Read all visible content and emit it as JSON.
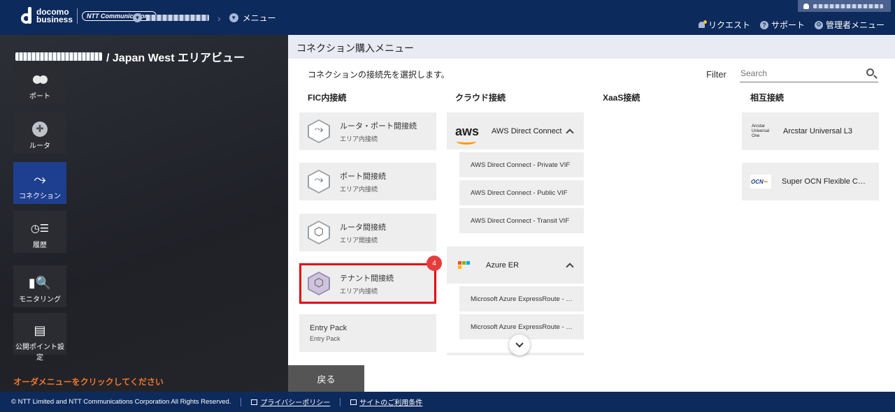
{
  "header": {
    "logo_line1": "docomo",
    "logo_line2": "business",
    "ntt_logo": "NTT Communications",
    "menu_crumb": "メニュー",
    "nav": {
      "request": "リクエスト",
      "support": "サポート",
      "admin_menu": "管理者メニュー"
    }
  },
  "left_panel": {
    "area_title": "/ Japan West エリアビュー",
    "items": [
      {
        "label": "ポート",
        "icon": "port-icon"
      },
      {
        "label": "ルータ",
        "icon": "router-icon"
      },
      {
        "label": "コネクション",
        "icon": "connection-icon"
      },
      {
        "label": "履歴",
        "icon": "history-icon"
      },
      {
        "label": "モニタリング",
        "icon": "monitoring-icon"
      },
      {
        "label": "公開ポイント設定",
        "icon": "public-point-icon"
      }
    ],
    "order_hint": "オーダメニューをクリックしてください"
  },
  "main": {
    "title": "コネクション購入メニュー",
    "instruction": "コネクションの接続先を選択します。",
    "filter_label": "Filter",
    "search_placeholder": "Search",
    "columns": {
      "fic": "FIC内接続",
      "cloud": "クラウド接続",
      "xaas": "XaaS接続",
      "mutual": "相互接続"
    },
    "fic_cards": [
      {
        "title": "ルータ・ポート間接続",
        "sub": "エリア内接続"
      },
      {
        "title": "ポート間接続",
        "sub": "エリア内接続"
      },
      {
        "title": "ルータ間接続",
        "sub": "エリア間接続"
      },
      {
        "title": "テナント間接続",
        "sub": "エリア内接続"
      },
      {
        "title": "Entry Pack",
        "sub": "Entry Pack"
      }
    ],
    "step_badge": "4",
    "cloud": {
      "aws": {
        "logo_text": "aws",
        "name": "AWS Direct Connect",
        "items": [
          "AWS Direct Connect - Private VIF",
          "AWS Direct Connect - Public VIF",
          "AWS Direct Connect - Transit VIF"
        ]
      },
      "azure": {
        "name": "Azure ER",
        "items": [
          "Microsoft Azure ExpressRoute - Private Peering",
          "Microsoft Azure ExpressRoute - Microsoft Peering"
        ]
      }
    },
    "mutual_cards": [
      {
        "logo": "Arcstar Universal One",
        "name": "Arcstar Universal L3"
      },
      {
        "logo": "OCN",
        "name": "Super OCN Flexible Connect"
      }
    ],
    "back_label": "戻る"
  },
  "footer": {
    "copyright": "© NTT Limited and NTT Communications Corporation All Rights Reserved.",
    "privacy": "プライバシーポリシー",
    "terms": "サイトのご利用条件"
  },
  "colors": {
    "header_bg": "#0d2a5c",
    "active_side": "#1e3f8f",
    "highlight": "#e60012",
    "order_hint": "#f0762a"
  }
}
